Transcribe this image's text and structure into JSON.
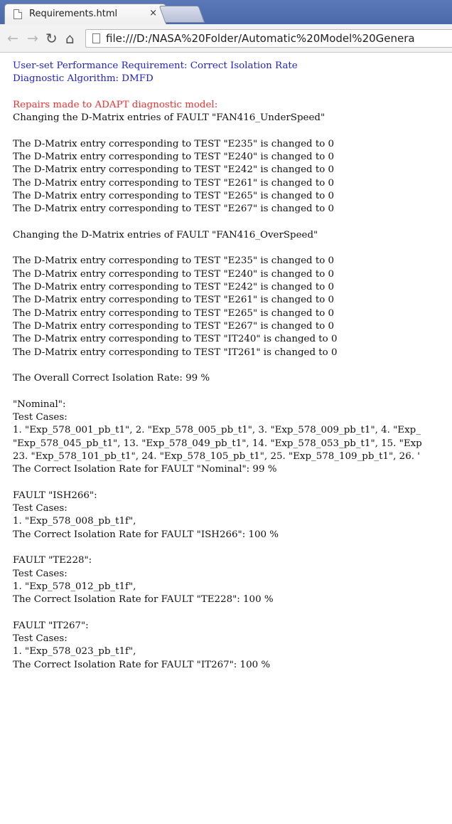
{
  "browser": {
    "tab_title": "Requirements.html",
    "tab_close": "×",
    "url": "file:///D:/NASA%20Folder/Automatic%20Model%20Genera",
    "icons": {
      "back": "back-arrow-icon",
      "forward": "forward-arrow-icon",
      "reload": "reload-icon",
      "home": "home-icon",
      "tab_page": "page-icon",
      "url_page": "page-icon"
    }
  },
  "content": {
    "header": {
      "requirement": "User-set Performance Requirement: Correct Isolation Rate",
      "algorithm": "Diagnostic Algorithm: DMFD",
      "repairs": "Repairs made to ADAPT diagnostic model:",
      "colors": {
        "blue": "#2323c8",
        "red": "#f03030"
      }
    },
    "underspeed": {
      "heading": "Changing the D-Matrix entries of FAULT \"FAN416_UnderSpeed\"",
      "lines": [
        "The D-Matrix entry corresponding to TEST \"E235\" is changed to 0",
        "The D-Matrix entry corresponding to TEST \"E240\" is changed to 0",
        "The D-Matrix entry corresponding to TEST \"E242\" is changed to 0",
        "The D-Matrix entry corresponding to TEST \"E261\" is changed to 0",
        "The D-Matrix entry corresponding to TEST \"E265\" is changed to 0",
        "The D-Matrix entry corresponding to TEST \"E267\" is changed to 0"
      ]
    },
    "overspeed": {
      "heading": "Changing the D-Matrix entries of FAULT \"FAN416_OverSpeed\"",
      "lines": [
        "The D-Matrix entry corresponding to TEST \"E235\" is changed to 0",
        "The D-Matrix entry corresponding to TEST \"E240\" is changed to 0",
        "The D-Matrix entry corresponding to TEST \"E242\" is changed to 0",
        "The D-Matrix entry corresponding to TEST \"E261\" is changed to 0",
        "The D-Matrix entry corresponding to TEST \"E265\" is changed to 0",
        "The D-Matrix entry corresponding to TEST \"E267\" is changed to 0",
        "The D-Matrix entry corresponding to TEST \"IT240\" is changed to 0",
        "The D-Matrix entry corresponding to TEST \"IT261\" is changed to 0"
      ]
    },
    "overall_rate": "The Overall Correct Isolation Rate: 99 %",
    "nominal": {
      "heading": "\"Nominal\":",
      "test_cases_label": "Test Cases:",
      "lines": [
        "1. \"Exp_578_001_pb_t1\", 2. \"Exp_578_005_pb_t1\", 3. \"Exp_578_009_pb_t1\", 4. \"Exp_",
        "\"Exp_578_045_pb_t1\", 13. \"Exp_578_049_pb_t1\", 14. \"Exp_578_053_pb_t1\", 15. \"Exp",
        "23. \"Exp_578_101_pb_t1\", 24. \"Exp_578_105_pb_t1\", 25. \"Exp_578_109_pb_t1\", 26. '"
      ],
      "rate": "The Correct Isolation Rate for FAULT \"Nominal\": 99 %"
    },
    "faults": [
      {
        "heading": "FAULT \"ISH266\":",
        "test_cases_label": "Test Cases:",
        "case": "1. \"Exp_578_008_pb_t1f\",",
        "rate": "The Correct Isolation Rate for FAULT \"ISH266\": 100 %"
      },
      {
        "heading": "FAULT \"TE228\":",
        "test_cases_label": "Test Cases:",
        "case": "1. \"Exp_578_012_pb_t1f\",",
        "rate": "The Correct Isolation Rate for FAULT \"TE228\": 100 %"
      },
      {
        "heading": "FAULT \"IT267\":",
        "test_cases_label": "Test Cases:",
        "case": "1. \"Exp_578_023_pb_t1f\",",
        "rate": "The Correct Isolation Rate for FAULT \"IT267\": 100 %"
      }
    ]
  }
}
